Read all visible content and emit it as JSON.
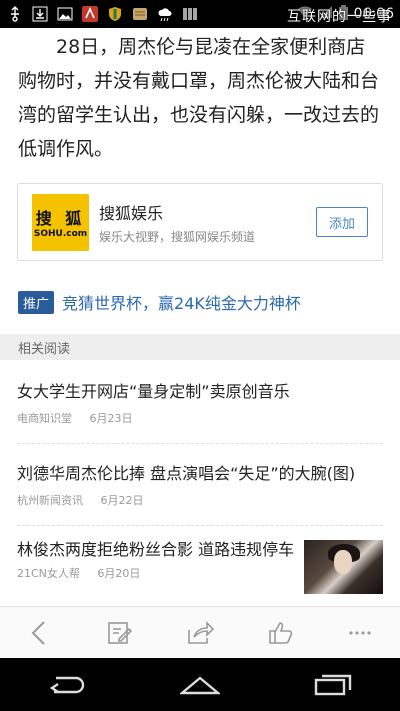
{
  "status_bar": {
    "overlay_text": "互联网的一些事",
    "time": "06:06"
  },
  "article": {
    "paragraph": "28日，周杰伦与昆凌在全家便利商店购物时，并没有戴口罩，周杰伦被大陆和台湾的留学生认出，也没有闪躲，一改过去的低调作风。"
  },
  "channel_card": {
    "logo_top": "搜 狐",
    "logo_bottom": "SOHU.com",
    "title": "搜狐娱乐",
    "subtitle": "娱乐大视野，搜狐网娱乐频道",
    "add_label": "添加"
  },
  "promo": {
    "badge": "推广",
    "text": "竞猜世界杯，赢24K纯金大力神杯"
  },
  "related": {
    "header": "相关阅读",
    "items": [
      {
        "title": "女大学生开网店“量身定制”卖原创音乐",
        "source": "电商知识堂",
        "date": "6月23日"
      },
      {
        "title": "刘德华周杰伦比捧 盘点演唱会“失足”的大腕(图)",
        "source": "杭州新闻资讯",
        "date": "6月22日"
      },
      {
        "title": "林俊杰两度拒绝粉丝合影 道路违规停车",
        "source": "21CN女人帮",
        "date": "6月20日"
      }
    ]
  },
  "toolbar": {
    "icons": [
      "back-icon",
      "comment-edit-icon",
      "share-icon",
      "like-icon",
      "more-icon"
    ]
  },
  "colors": {
    "accent": "#2d69b0",
    "badge": "#2a5b9a",
    "logo_bg": "#f5c200"
  }
}
